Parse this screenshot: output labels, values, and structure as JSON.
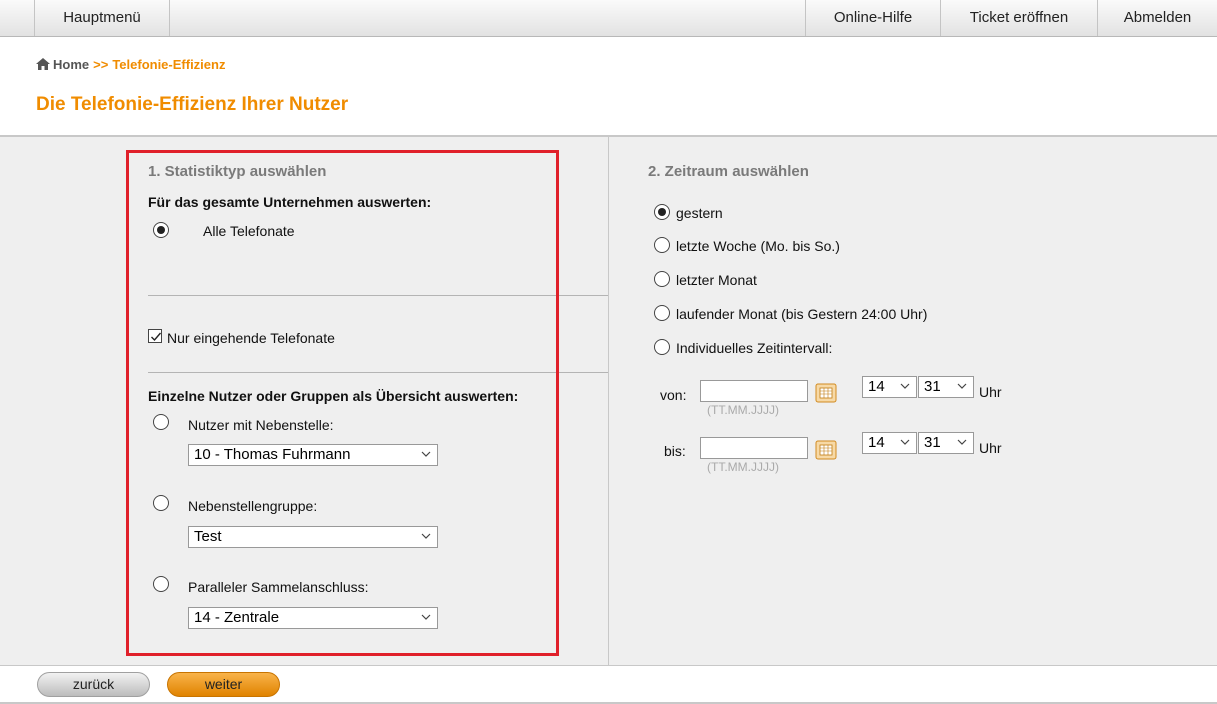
{
  "nav": {
    "main_menu": "Hauptmenü",
    "help": "Online-Hilfe",
    "ticket": "Ticket eröffnen",
    "logout": "Abmelden"
  },
  "breadcrumb": {
    "home": "Home",
    "separator": ">>",
    "current": "Telefonie-Effizienz"
  },
  "page_title": "Die Telefonie-Effizienz Ihrer Nutzer",
  "section1": {
    "title": "1. Statistiktyp auswählen",
    "company_heading": "Für das gesamte Unternehmen auswerten:",
    "all_calls": "Alle Telefonate",
    "incoming_only": "Nur eingehende Telefonate",
    "incoming_only_checked": true,
    "individual_heading": "Einzelne Nutzer oder Gruppen als Übersicht auswerten:",
    "user_ext_label": "Nutzer mit Nebenstelle:",
    "user_ext_value": "10 - Thomas Fuhrmann",
    "ext_group_label": "Nebenstellengruppe:",
    "ext_group_value": "Test",
    "hunt_group_label": "Paralleler Sammelanschluss:",
    "hunt_group_value": "14 - Zentrale"
  },
  "section2": {
    "title": "2. Zeitraum auswählen",
    "options": [
      "gestern",
      "letzte Woche (Mo. bis So.)",
      "letzter Monat",
      "laufender Monat (bis Gestern 24:00 Uhr)",
      "Individuelles Zeitintervall:"
    ],
    "from_label": "von:",
    "to_label": "bis:",
    "date_hint": "(TT.MM.JJJJ)",
    "hour_value": "14",
    "minute_value": "31",
    "uhr": "Uhr"
  },
  "footer": {
    "back": "zurück",
    "next": "weiter"
  },
  "colors": {
    "accent": "#f08c00",
    "highlight_box": "#e0202a"
  }
}
